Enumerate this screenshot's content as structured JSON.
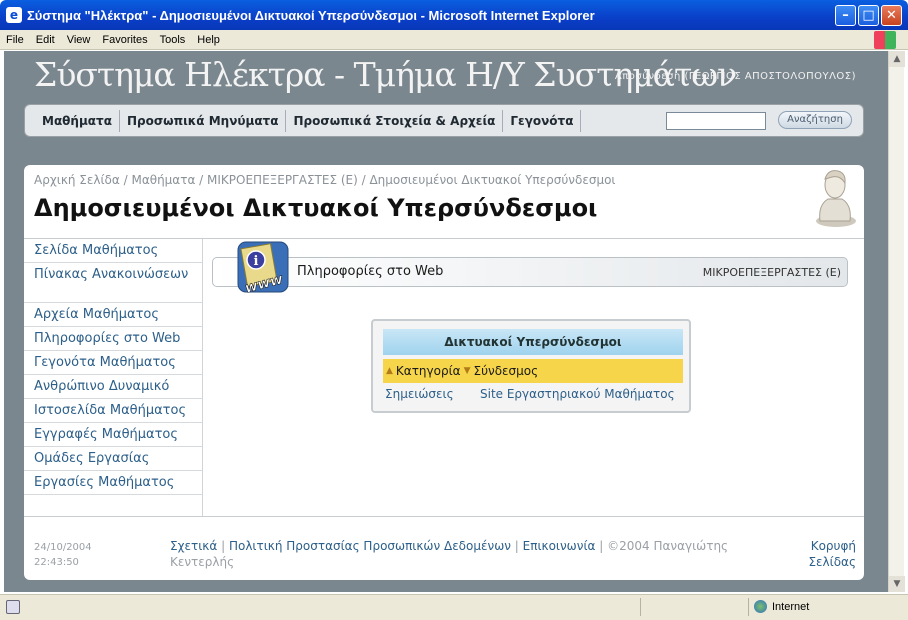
{
  "window": {
    "title": "Σύστημα \"Ηλέκτρα\" - Δημοσιευμένοι Δικτυακοί Υπερσύνδεσμοι - Microsoft Internet Explorer",
    "min": "–",
    "max": "□",
    "close": "✕"
  },
  "menu": [
    "File",
    "Edit",
    "View",
    "Favorites",
    "Tools",
    "Help"
  ],
  "site": {
    "title": "Σύστημα Ηλέκτρα - Τμήμα Η/Υ Συστημάτων",
    "logout": "Αποσύνδεση (ΓΕΩΡΓΙΟΣ ΑΠΟΣΤΟΛΟΠΟΥΛΟΣ)"
  },
  "nav": {
    "items": [
      "Μαθήματα",
      "Προσωπικά Μηνύματα",
      "Προσωπικά Στοιχεία & Αρχεία",
      "Γεγονότα"
    ],
    "search_button": "Αναζήτηση",
    "search_value": ""
  },
  "page": {
    "breadcrumb": "Αρχική Σελίδα / Μαθήματα / ΜΙΚΡΟΕΠΕΞΕΡΓΑΣΤΕΣ (Ε) / Δημοσιευμένοι Δικτυακοί Υπερσύνδεσμοι",
    "title": "Δημοσιευμένοι Δικτυακοί Υπερσύνδεσμοι"
  },
  "sidebar": [
    "Σελίδα Μαθήματος",
    "Πίνακας Ανακοινώσεων",
    "Αρχεία Μαθήματος",
    "Πληροφορίες στο Web",
    "Γεγονότα Μαθήματος",
    "Ανθρώπινο Δυναμικό",
    "Ιστοσελίδα Μαθήματος",
    "Εγγραφές Μαθήματος",
    "Ομάδες Εργασίας",
    "Εργασίες Μαθήματος"
  ],
  "infobar": {
    "label": "Πληροφορίες στο Web",
    "course": "ΜΙΚΡΟΕΠΕΞΕΡΓΑΣΤΕΣ (Ε)",
    "icon_text": "www"
  },
  "links_table": {
    "header": "Δικτυακοί Υπερσύνδεσμοι",
    "col_category": "Κατηγορία",
    "col_link": "Σύνδεσμος",
    "rows": [
      {
        "category": "Σημειώσεις",
        "link": "Site Εργαστηριακού Μαθήματος"
      }
    ]
  },
  "footer": {
    "date": "24/10/2004",
    "time": "22:43:50",
    "links": [
      "Σχετικά",
      "Πολιτική Προστασίας Προσωπικών Δεδομένων",
      "Επικοινωνία"
    ],
    "copyright": "©2004 Παναγιώτης Κεντερλής",
    "top_link": "Κορυφή Σελίδας"
  },
  "status": {
    "zone": "Internet"
  }
}
